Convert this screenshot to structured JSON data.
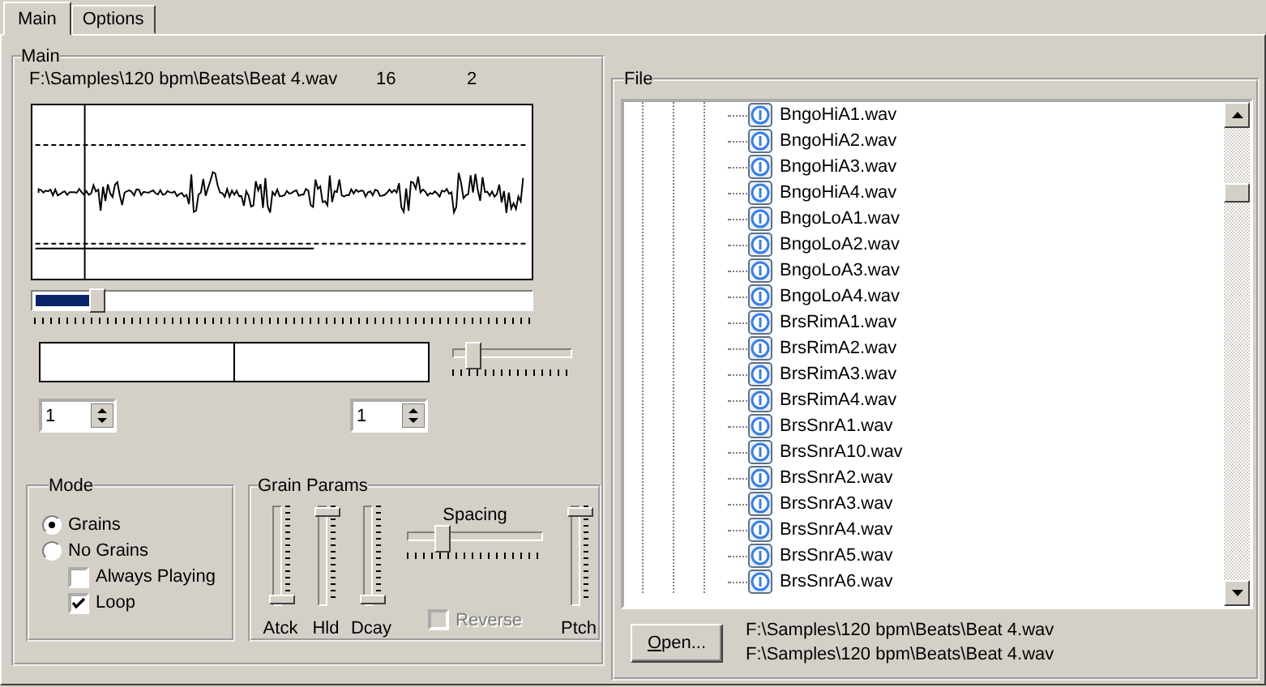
{
  "tabs": [
    {
      "label": "Main",
      "selected": true
    },
    {
      "label": "Options",
      "selected": false
    }
  ],
  "main": {
    "title": "Main",
    "file_path": "F:\\Samples\\120 bpm\\Beats\\Beat 4.wav",
    "value_1": "16",
    "value_2": "2",
    "position_slider": {
      "level": 0.11
    },
    "zoom_slider": {
      "level": 0.12
    },
    "spin_left": {
      "value": "1"
    },
    "spin_right": {
      "value": "1"
    }
  },
  "mode": {
    "title": "Mode",
    "options": [
      {
        "label": "Grains",
        "selected": true
      },
      {
        "label": "No Grains",
        "selected": false
      }
    ],
    "checkboxes": [
      {
        "label": "Always Playing",
        "checked": false
      },
      {
        "label": "Loop",
        "checked": true
      }
    ]
  },
  "grain_params": {
    "title": "Grain Params",
    "sliders": [
      {
        "label": "Atck",
        "level": 0
      },
      {
        "label": "Hld",
        "level": 1
      },
      {
        "label": "Dcay",
        "level": 0
      }
    ],
    "spacing": {
      "label": "Spacing",
      "level": 0.23
    },
    "reverse": {
      "label": "Reverse",
      "checked": false,
      "disabled": true
    },
    "pitch": {
      "label": "Ptch",
      "level": 1
    }
  },
  "file": {
    "title": "File",
    "items": [
      "BngoHiA1.wav",
      "BngoHiA2.wav",
      "BngoHiA3.wav",
      "BngoHiA4.wav",
      "BngoLoA1.wav",
      "BngoLoA2.wav",
      "BngoLoA3.wav",
      "BngoLoA4.wav",
      "BrsRimA1.wav",
      "BrsRimA2.wav",
      "BrsRimA3.wav",
      "BrsRimA4.wav",
      "BrsSnrA1.wav",
      "BrsSnrA10.wav",
      "BrsSnrA2.wav",
      "BrsSnrA3.wav",
      "BrsSnrA4.wav",
      "BrsSnrA5.wav",
      "BrsSnrA6.wav"
    ],
    "open_button": "Open...",
    "paths": [
      "F:\\Samples\\120 bpm\\Beats\\Beat 4.wav",
      "F:\\Samples\\120 bpm\\Beats\\Beat 4.wav"
    ]
  }
}
